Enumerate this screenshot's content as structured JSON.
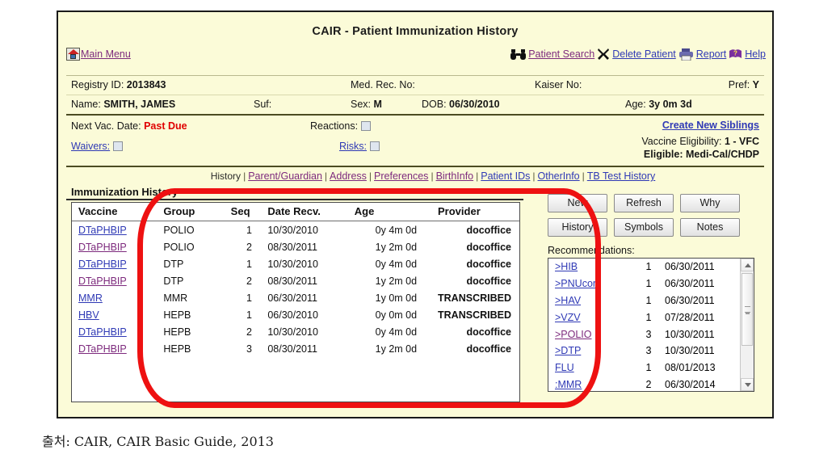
{
  "window": {
    "title": "CAIR - Patient Immunization History"
  },
  "toolbar": {
    "home_icon": "home-icon",
    "main_menu": "Main Menu",
    "search_icon": "binoculars-icon",
    "patient_search": "Patient Search",
    "delete_icon": "x-close-icon",
    "delete_patient": "Delete Patient",
    "printer_icon": "printer-icon",
    "report": "Report",
    "help_icon": "help-book-icon",
    "help": "Help"
  },
  "demographics": {
    "registry_id_label": "Registry ID:",
    "registry_id_value": "2013843",
    "med_rec_label": "Med. Rec. No:",
    "med_rec_value": "",
    "kaiser_label": "Kaiser No:",
    "kaiser_value": "",
    "pref_label": "Pref:",
    "pref_value": "Y",
    "name_label": "Name:",
    "name_value": "SMITH, JAMES",
    "suf_label": "Suf:",
    "suf_value": "",
    "sex_label": "Sex:",
    "sex_value": "M",
    "dob_label": "DOB:",
    "dob_value": "06/30/2010",
    "age_label": "Age:",
    "age_value": "3y 0m 3d"
  },
  "status": {
    "next_vac_label": "Next Vac. Date:",
    "next_vac_value": "Past Due",
    "next_vac_color": "#e00000",
    "reactions_label": "Reactions:",
    "waivers_label": "Waivers:",
    "risks_label": "Risks:",
    "create_siblings": "Create New Siblings",
    "eligibility_label": "Vaccine Eligibility:",
    "eligibility_value": "1 - VFC",
    "eligible_label": "Eligible:",
    "eligible_value": "Medi-Cal/CHDP"
  },
  "nav_tabs": [
    {
      "label": "History",
      "active": true
    },
    {
      "label": "Parent/Guardian",
      "active": false
    },
    {
      "label": "Address",
      "active": false
    },
    {
      "label": "Preferences",
      "active": false
    },
    {
      "label": "BirthInfo",
      "active": false
    },
    {
      "label": "Patient IDs",
      "active": false
    },
    {
      "label": "OtherInfo",
      "active": false
    },
    {
      "label": "TB Test History",
      "active": false
    }
  ],
  "immunization": {
    "section_title": "Immunization History",
    "columns": [
      "Vaccine",
      "Group",
      "Seq",
      "Date Recv.",
      "Age",
      "Provider"
    ],
    "rows": [
      {
        "vaccine": "DTaPHBIP",
        "group": "POLIO",
        "seq": "1",
        "date": "10/30/2010",
        "age": "0y 4m 0d",
        "provider": "docoffice",
        "visited": false
      },
      {
        "vaccine": "DTaPHBIP",
        "group": "POLIO",
        "seq": "2",
        "date": "08/30/2011",
        "age": "1y 2m 0d",
        "provider": "docoffice",
        "visited": true
      },
      {
        "vaccine": "DTaPHBIP",
        "group": "DTP",
        "seq": "1",
        "date": "10/30/2010",
        "age": "0y 4m 0d",
        "provider": "docoffice",
        "visited": false
      },
      {
        "vaccine": "DTaPHBIP",
        "group": "DTP",
        "seq": "2",
        "date": "08/30/2011",
        "age": "1y 2m 0d",
        "provider": "docoffice",
        "visited": true
      },
      {
        "vaccine": "MMR",
        "group": "MMR",
        "seq": "1",
        "date": "06/30/2011",
        "age": "1y 0m 0d",
        "provider": "TRANSCRIBED",
        "visited": false
      },
      {
        "vaccine": "HBV",
        "group": "HEPB",
        "seq": "1",
        "date": "06/30/2010",
        "age": "0y 0m 0d",
        "provider": "TRANSCRIBED",
        "visited": false
      },
      {
        "vaccine": "DTaPHBIP",
        "group": "HEPB",
        "seq": "2",
        "date": "10/30/2010",
        "age": "0y 4m 0d",
        "provider": "docoffice",
        "visited": false
      },
      {
        "vaccine": "DTaPHBIP",
        "group": "HEPB",
        "seq": "3",
        "date": "08/30/2011",
        "age": "1y 2m 0d",
        "provider": "docoffice",
        "visited": true
      }
    ]
  },
  "buttons": [
    "New",
    "Refresh",
    "Why",
    "History",
    "Symbols",
    "Notes"
  ],
  "recommendations": {
    "label": "Recommendations:",
    "rows": [
      {
        "name": ">HIB",
        "seq": "1",
        "date": "06/30/2011",
        "visited": false
      },
      {
        "name": ">PNUcon",
        "seq": "1",
        "date": "06/30/2011",
        "visited": false
      },
      {
        "name": ">HAV",
        "seq": "1",
        "date": "06/30/2011",
        "visited": false
      },
      {
        "name": ">VZV",
        "seq": "1",
        "date": "07/28/2011",
        "visited": false
      },
      {
        "name": ">POLIO",
        "seq": "3",
        "date": "10/30/2011",
        "visited": true
      },
      {
        "name": ">DTP",
        "seq": "3",
        "date": "10/30/2011",
        "visited": false
      },
      {
        "name": "FLU",
        "seq": "1",
        "date": "08/01/2013",
        "visited": false
      },
      {
        "name": ":MMR",
        "seq": "2",
        "date": "06/30/2014",
        "visited": false
      }
    ]
  },
  "annotation": {
    "shape": "red-oval-highlight",
    "color": "#ee1111"
  },
  "caption": "출처: CAIR, CAIR Basic Guide, 2013"
}
